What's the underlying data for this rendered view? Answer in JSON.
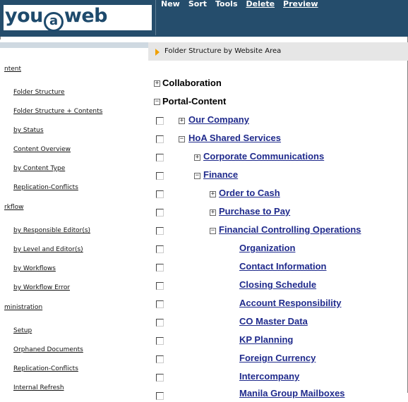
{
  "header": {
    "logo": "you@web",
    "menu": [
      "New",
      "Sort",
      "Tools",
      "Delete",
      "Preview"
    ]
  },
  "breadcrumb": "Folder Structure by Website Area",
  "nav": {
    "sections": [
      {
        "title": "ntent",
        "items": [
          "Folder Structure",
          "Folder Structure + Contents",
          "by Status",
          "Content Overview",
          "by Content Type",
          "Replication-Conflicts"
        ]
      },
      {
        "title": "rkflow",
        "items": [
          "by Responsible Editor(s)",
          "by Level and Editor(s)",
          "by Workflows",
          "by Workflow Error"
        ]
      },
      {
        "title": "ministration",
        "items": [
          "Setup",
          "Orphaned Documents",
          "Replication-Conflicts",
          "Internal Refresh"
        ]
      }
    ]
  },
  "tree": {
    "roots": [
      "Collaboration",
      "Portal-Content"
    ],
    "nodes": [
      "Our Company",
      "HoA Shared Services",
      "Corporate Communications",
      "Finance",
      "Order to Cash",
      "Purchase to Pay",
      "Financial Controlling Operations",
      "Organization",
      "Contact Information",
      "Closing Schedule",
      "Account Responsibility",
      "CO Master Data",
      "KP Planning",
      "Foreign Currency",
      "Intercompany",
      "Manila Group Mailboxes"
    ]
  },
  "colors": {
    "header_bg": "#254d6c",
    "link": "#1f2a8c",
    "nav_band": "#cfd9e1",
    "breadcrumb_bg": "#e6e6e6",
    "arrow": "#f0a000"
  }
}
